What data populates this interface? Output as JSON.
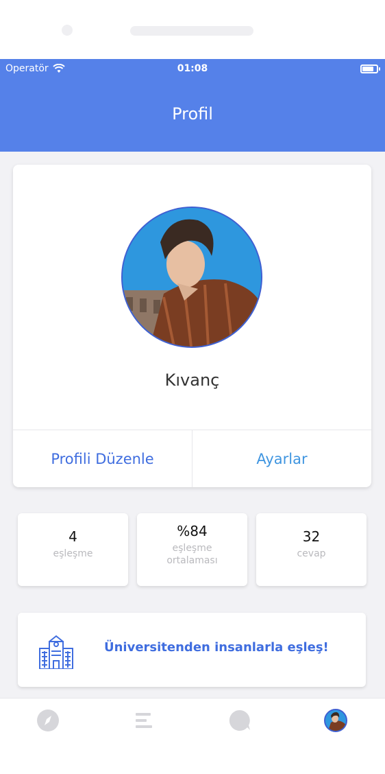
{
  "status_bar": {
    "carrier": "Operatör",
    "time": "01:08"
  },
  "nav": {
    "title": "Profil"
  },
  "profile": {
    "name": "Kıvanç",
    "edit_label": "Profili Düzenle",
    "settings_label": "Ayarlar"
  },
  "stats": [
    {
      "value": "4",
      "label": "eşleşme"
    },
    {
      "value": "%84",
      "label": "eşleşme ortalaması"
    },
    {
      "value": "32",
      "label": "cevap"
    }
  ],
  "university_banner": {
    "text": "Üniversitenden insanlarla eşleş!",
    "icon": "school-building-icon"
  },
  "tabbar": {
    "items": [
      {
        "icon": "compass-icon"
      },
      {
        "icon": "menu-lines-icon"
      },
      {
        "icon": "chat-bubble-icon"
      },
      {
        "icon": "profile-avatar"
      }
    ]
  },
  "colors": {
    "header": "#5581e9",
    "accent": "#3f6ddf",
    "settings": "#3f95e0",
    "inactive_tab": "#d6d6da"
  }
}
